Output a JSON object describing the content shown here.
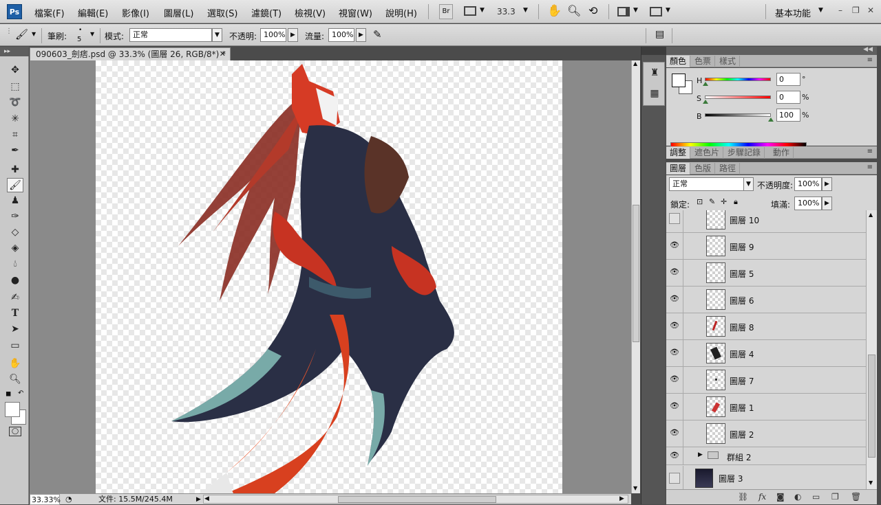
{
  "app": {
    "logo": "Ps"
  },
  "menu": {
    "items": [
      "檔案(F)",
      "編輯(E)",
      "影像(I)",
      "圖層(L)",
      "選取(S)",
      "濾鏡(T)",
      "檢視(V)",
      "視窗(W)",
      "說明(H)"
    ],
    "bridge_label": "Br",
    "zoom": "33.3",
    "workspace": "基本功能",
    "window_controls": [
      "–",
      "❐",
      "✕"
    ]
  },
  "options": {
    "brush_label": "筆刷:",
    "brush_size": "5",
    "mode_label": "模式:",
    "mode_value": "正常",
    "opacity_label": "不透明:",
    "opacity_value": "100%",
    "flow_label": "流量:",
    "flow_value": "100%"
  },
  "toolbar": {
    "icons": [
      "move-icon",
      "marquee-icon",
      "lasso-icon",
      "magic-wand-icon",
      "crop-icon",
      "eyedropper-icon",
      "healing-brush-icon",
      "brush-icon",
      "clone-stamp-icon",
      "history-brush-icon",
      "eraser-icon",
      "paint-bucket-icon",
      "blur-icon",
      "dodge-icon",
      "pen-icon",
      "type-icon",
      "path-select-icon",
      "rectangle-icon",
      "hand-icon",
      "zoom-icon",
      "quick-mask-icon"
    ]
  },
  "document": {
    "tab_title": "090603_劍痞.psd @ 33.3% (圖層 26, RGB/8*) *",
    "status_zoom": "33.33%",
    "doc_size": "文件: 15.5M/245.4M"
  },
  "color_panel": {
    "tabs": [
      "顏色",
      "色票",
      "樣式"
    ],
    "h_label": "H",
    "h_value": "0",
    "h_unit": "°",
    "s_label": "S",
    "s_value": "0",
    "s_unit": "%",
    "b_label": "B",
    "b_value": "100",
    "b_unit": "%"
  },
  "adjust_panel": {
    "tabs": [
      "調整",
      "遮色片",
      "步驟記錄",
      "動作"
    ]
  },
  "layers_panel": {
    "tabs": [
      "圖層",
      "色版",
      "路徑"
    ],
    "blend_mode": "正常",
    "opacity_label": "不透明度:",
    "opacity_value": "100%",
    "lock_label": "鎖定:",
    "fill_label": "填滿:",
    "fill_value": "100%",
    "layers": [
      {
        "name": "圖層 10",
        "visible": false,
        "type": "layer"
      },
      {
        "name": "圖層 9",
        "visible": true,
        "type": "layer"
      },
      {
        "name": "圖層 5",
        "visible": true,
        "type": "layer"
      },
      {
        "name": "圖層 6",
        "visible": true,
        "type": "layer"
      },
      {
        "name": "圖層 8",
        "visible": true,
        "type": "layer"
      },
      {
        "name": "圖層 4",
        "visible": true,
        "type": "layer"
      },
      {
        "name": "圖層 7",
        "visible": true,
        "type": "layer"
      },
      {
        "name": "圖層 1",
        "visible": true,
        "type": "layer"
      },
      {
        "name": "圖層 2",
        "visible": true,
        "type": "layer"
      },
      {
        "name": "群組 2",
        "visible": true,
        "type": "group"
      },
      {
        "name": "圖層 3",
        "visible": false,
        "type": "layer"
      }
    ]
  }
}
